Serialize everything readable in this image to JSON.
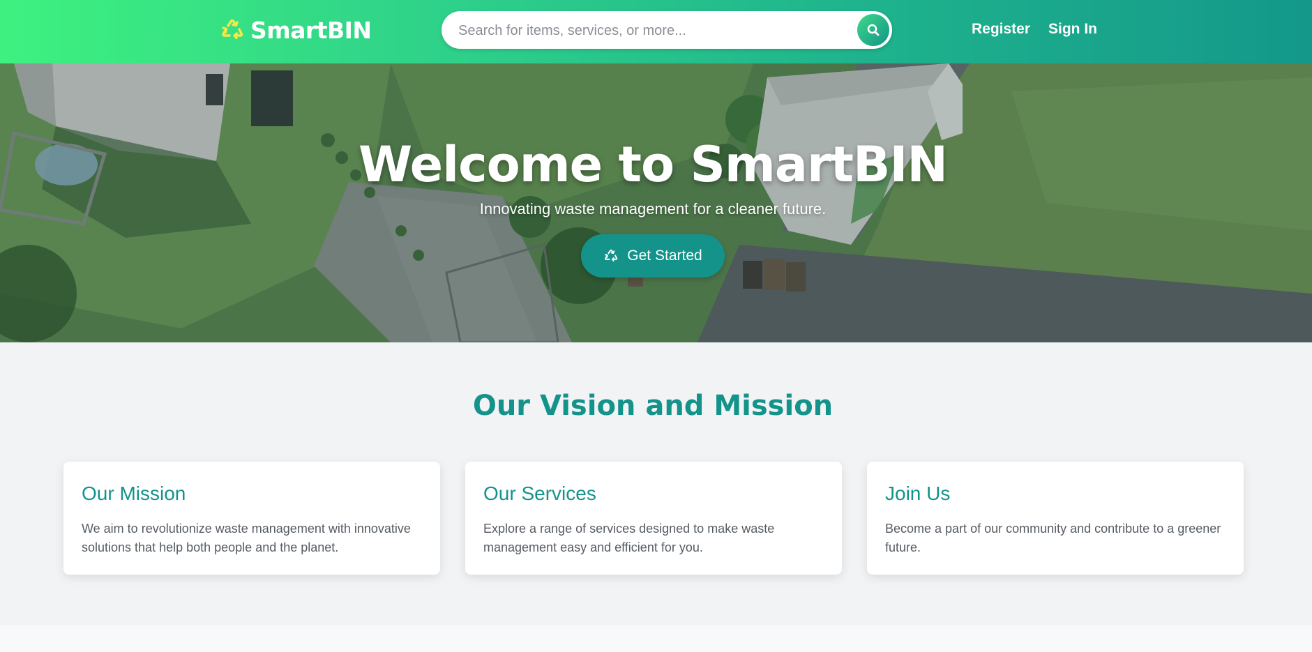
{
  "brand": {
    "name": "SmartBIN",
    "logo_icon": "recycle-icon",
    "colors": {
      "primary": "#13938a",
      "header_gradient_start": "#3ef17f",
      "header_gradient_end": "#14988a",
      "logo_icon": "#f6e84a"
    }
  },
  "header": {
    "search": {
      "placeholder": "Search for items, services, or more...",
      "value": "",
      "button_icon": "search-icon"
    },
    "nav": {
      "register": "Register",
      "sign_in": "Sign In"
    }
  },
  "hero": {
    "title": "Welcome to SmartBIN",
    "subtitle": "Innovating waste management for a cleaner future.",
    "cta": {
      "label": "Get Started",
      "icon": "recycle-icon"
    }
  },
  "vision": {
    "title": "Our Vision and Mission",
    "cards": [
      {
        "title": "Our Mission",
        "text": "We aim to revolutionize waste management with innovative solutions that help both people and the planet."
      },
      {
        "title": "Our Services",
        "text": "Explore a range of services designed to make waste management easy and efficient for you."
      },
      {
        "title": "Join Us",
        "text": "Become a part of our community and contribute to a greener future."
      }
    ]
  }
}
